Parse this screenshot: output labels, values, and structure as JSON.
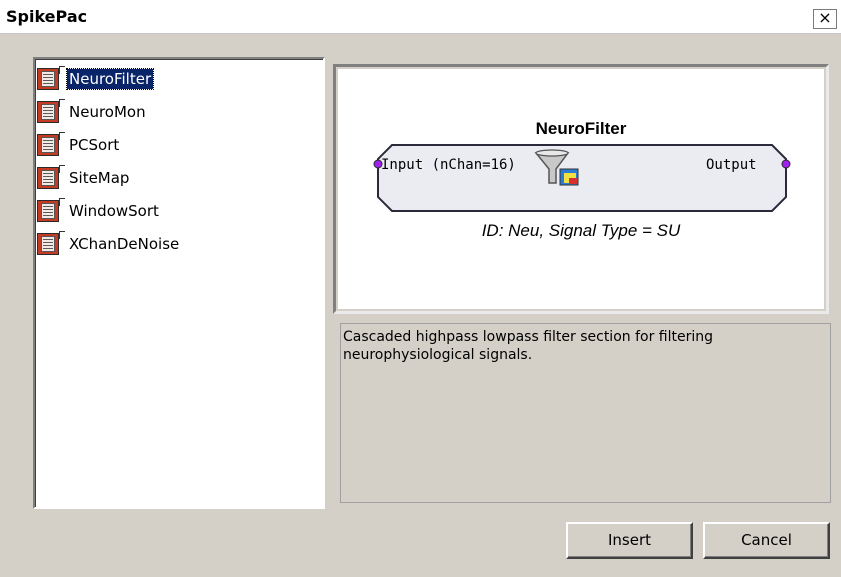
{
  "window": {
    "title": "SpikePac",
    "close_label": "×"
  },
  "blocks": [
    {
      "label": "NeuroFilter",
      "selected": true,
      "icon": "block-icon"
    },
    {
      "label": "NeuroMon",
      "selected": false,
      "icon": "block-icon"
    },
    {
      "label": "PCSort",
      "selected": false,
      "icon": "block-icon"
    },
    {
      "label": "SiteMap",
      "selected": false,
      "icon": "block-icon"
    },
    {
      "label": "WindowSort",
      "selected": false,
      "icon": "block-icon"
    },
    {
      "label": "XChanDeNoise",
      "selected": false,
      "icon": "block-icon"
    }
  ],
  "preview": {
    "title": "NeuroFilter",
    "input_label": "Input (nChan=16)",
    "output_label": "Output",
    "id_line": "ID: Neu,   Signal Type = SU",
    "icon": "funnel-icon",
    "port_color": "#a020f0"
  },
  "description": "Cascaded highpass lowpass filter section for filtering neurophysiological signals.",
  "buttons": {
    "insert": "Insert",
    "cancel": "Cancel"
  }
}
